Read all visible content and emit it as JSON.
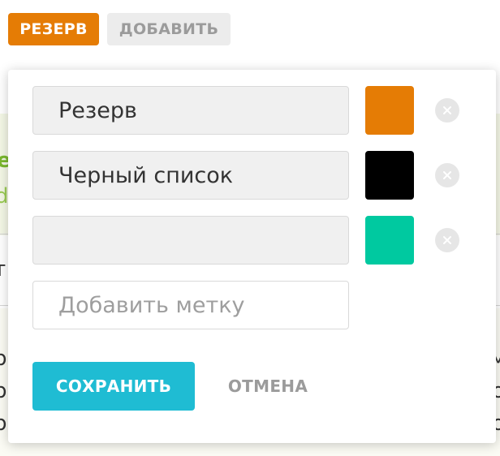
{
  "tag_bar": {
    "active_tag_label": "РЕЗЕРВ",
    "add_label": "ДОБАВИТЬ"
  },
  "editor": {
    "labels": [
      {
        "value": "Резерв",
        "color": "#e57c05"
      },
      {
        "value": "Черный список",
        "color": "#000000"
      },
      {
        "value": "",
        "color": "#00c9a0"
      }
    ],
    "new_label_placeholder": "Добавить метку",
    "save_label": "СОХРАНИТЬ",
    "cancel_label": "ОТМЕНА"
  },
  "background": {
    "partial_text": [
      "e",
      "d",
      "т",
      "р",
      "р",
      "р",
      "м",
      "о",
      "о"
    ]
  }
}
